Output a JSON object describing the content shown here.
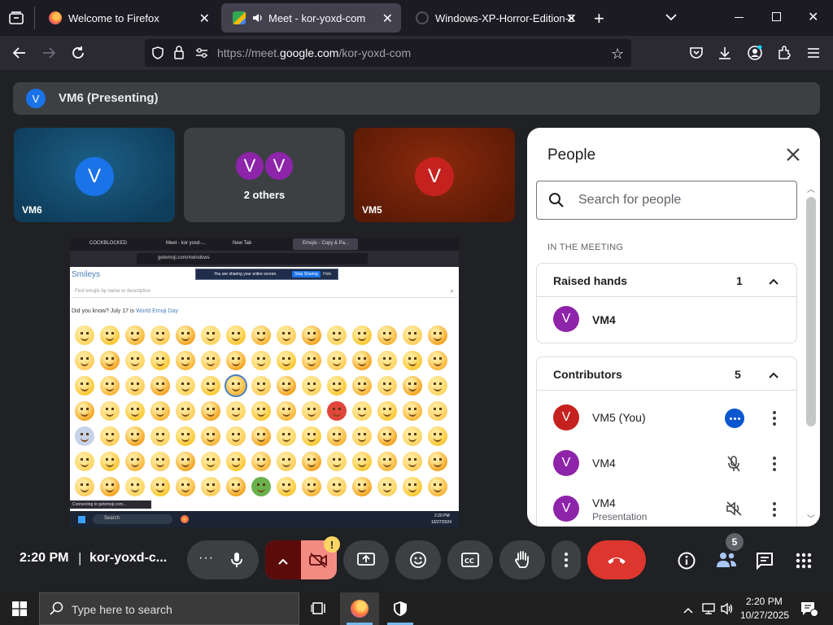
{
  "browser": {
    "tabs": [
      {
        "title": "Welcome to Firefox",
        "icon": "firefox-icon",
        "active": false
      },
      {
        "title": "Meet - kor-yoxd-com",
        "icon": "google-meet-icon",
        "active": true
      },
      {
        "title": "Windows-XP-Horror-Edition-BS",
        "icon": "loading-icon",
        "active": false
      }
    ],
    "url_prefix": "https://meet.",
    "url_domain": "google.com",
    "url_path": "/kor-yoxd-com"
  },
  "meet": {
    "presenting_banner": {
      "avatar_letter": "V",
      "text": "VM6 (Presenting)"
    },
    "tiles": [
      {
        "name": "VM6",
        "letter": "V",
        "color": "#1a73e8"
      },
      {
        "name": "2 others",
        "letters": [
          "V",
          "V"
        ],
        "color": "#8e24aa"
      },
      {
        "name": "VM5",
        "letter": "V",
        "color": "#c5221f"
      }
    ],
    "screen_share": {
      "tabs": [
        "COCKBLOCKED",
        "Meet - kor yoxd-...",
        "New Tab",
        "Emojis - Copy & Pa..."
      ],
      "url": "getemoji.com/#windows",
      "sharing_notice": "You are sharing your entire screen.",
      "stop_sharing_label": "Stop Sharing",
      "hide_label": "Hide",
      "page_title": "Smileys",
      "search_placeholder": "Find emojis by name or description",
      "did_you_know": "Did you know? July 17 is",
      "emoji_day": "World Emoji Day",
      "status_text": "Connecting to getemoji.com...",
      "taskbar_search": "Search",
      "clock_time": "2:20 PM",
      "clock_date": "10/27/2024"
    },
    "people_panel": {
      "title": "People",
      "search_placeholder": "Search for people",
      "in_meeting_label": "IN THE MEETING",
      "raised_hands": {
        "label": "Raised hands",
        "count": "1",
        "people": [
          {
            "name": "VM4",
            "letter": "V",
            "color": "#8e24aa"
          }
        ]
      },
      "contributors": {
        "label": "Contributors",
        "count": "5",
        "people": [
          {
            "name": "VM5 (You)",
            "letter": "V",
            "color": "#c5221f",
            "status": "more-options"
          },
          {
            "name": "VM4",
            "letter": "V",
            "color": "#8e24aa",
            "status": "mic-off"
          },
          {
            "name": "VM4",
            "sub": "Presentation",
            "letter": "V",
            "color": "#8e24aa",
            "status": "muted"
          }
        ]
      }
    },
    "bottom_bar": {
      "time": "2:20 PM",
      "separator": "|",
      "meeting_code": "kor-yoxd-c...",
      "warning_badge": "!",
      "people_count": "5"
    }
  },
  "taskbar": {
    "search_placeholder": "Type here to search",
    "time": "2:20 PM",
    "date": "10/27/2025"
  }
}
